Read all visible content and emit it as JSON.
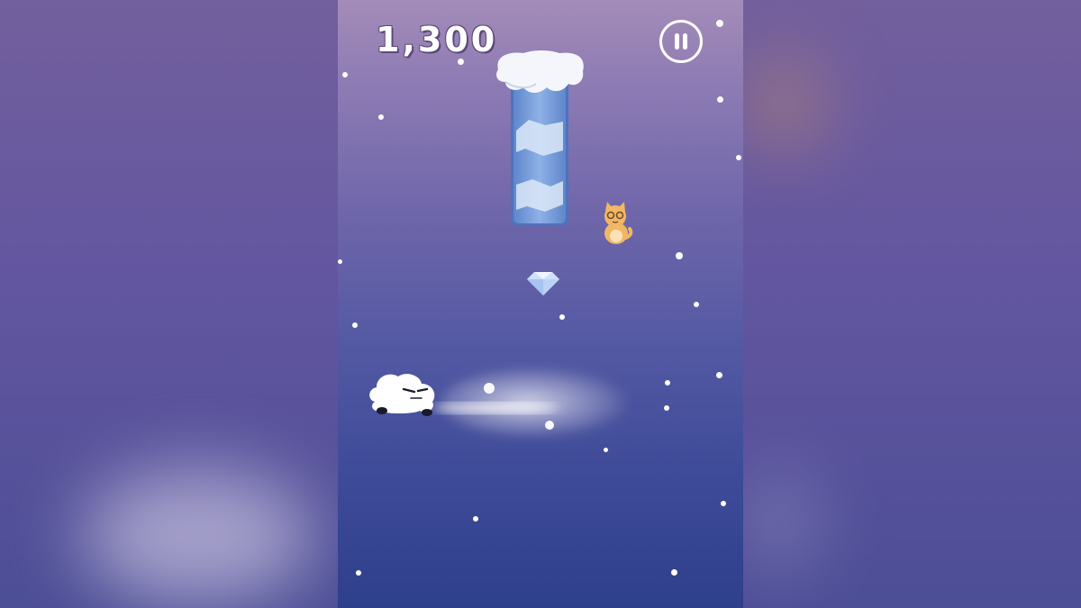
{
  "hud": {
    "score": "1,300",
    "pause_icon": "pause-icon"
  },
  "entities": {
    "obstacle": "ice-pillar-icon",
    "pickup": "diamond-icon",
    "companion": "orange-cat-icon",
    "player": "cloud-character-icon"
  },
  "colors": {
    "sky_top": "#a48cb8",
    "sky_bottom": "#2e3f8c",
    "ice": "#7fa3dc",
    "snow_cap": "#f4f6fb",
    "cat": "#f0b25a"
  }
}
